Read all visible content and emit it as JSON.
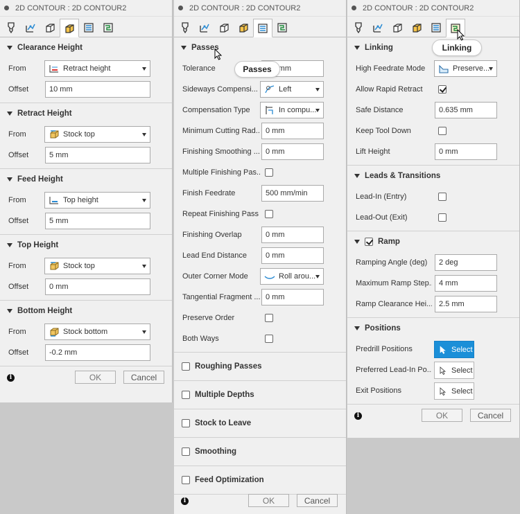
{
  "window_title": "2D CONTOUR : 2D CONTOUR2",
  "tabs": [
    "tool-icon",
    "geometry-icon",
    "heights-icon",
    "passes-icon",
    "linking-icon",
    "link-active-icon"
  ],
  "heights_panel": {
    "sections": [
      {
        "title": "Clearance Height",
        "from_label": "From",
        "from_value": "Retract height",
        "from_icon": "retract-height-icon",
        "offset_label": "Offset",
        "offset_value": "10 mm"
      },
      {
        "title": "Retract Height",
        "from_label": "From",
        "from_value": "Stock top",
        "from_icon": "stock-top-icon",
        "offset_label": "Offset",
        "offset_value": "5 mm"
      },
      {
        "title": "Feed Height",
        "from_label": "From",
        "from_value": "Top height",
        "from_icon": "top-height-icon",
        "offset_label": "Offset",
        "offset_value": "5 mm"
      },
      {
        "title": "Top Height",
        "from_label": "From",
        "from_value": "Stock top",
        "from_icon": "stock-top-icon",
        "offset_label": "Offset",
        "offset_value": "0 mm"
      },
      {
        "title": "Bottom Height",
        "from_label": "From",
        "from_value": "Stock bottom",
        "from_icon": "stock-bottom-icon",
        "offset_label": "Offset",
        "offset_value": "-0.2 mm"
      }
    ]
  },
  "passes_panel": {
    "section_title": "Passes",
    "tooltip": "Passes",
    "tolerance_label": "Tolerance",
    "tolerance_value": "mm",
    "sideways_label": "Sideways Compensi...",
    "sideways_value": "Left",
    "comp_type_label": "Compensation Type",
    "comp_type_value": "In compu...",
    "min_cut_label": "Minimum Cutting Rad...",
    "min_cut_value": "0 mm",
    "finish_smooth_label": "Finishing Smoothing ...",
    "finish_smooth_value": "0 mm",
    "multi_finish_label": "Multiple Finishing Pas...",
    "finish_feed_label": "Finish Feedrate",
    "finish_feed_value": "500 mm/min",
    "repeat_finish_label": "Repeat Finishing Pass",
    "finish_overlap_label": "Finishing Overlap",
    "finish_overlap_value": "0 mm",
    "lead_end_label": "Lead End Distance",
    "lead_end_value": "0 mm",
    "outer_corner_label": "Outer Corner Mode",
    "outer_corner_value": "Roll arou...",
    "tangential_label": "Tangential Fragment ...",
    "tangential_value": "0 mm",
    "preserve_label": "Preserve Order",
    "both_ways_label": "Both Ways",
    "collapsed_sections": [
      "Roughing Passes",
      "Multiple Depths",
      "Stock to Leave",
      "Smoothing",
      "Feed Optimization"
    ]
  },
  "linking_panel": {
    "section_title": "Linking",
    "tooltip": "Linking",
    "hf_mode_label": "High Feedrate Mode",
    "hf_mode_value": "Preserve...",
    "allow_rapid_label": "Allow Rapid Retract",
    "safe_dist_label": "Safe Distance",
    "safe_dist_value": "0.635 mm",
    "keep_tool_label": "Keep Tool Down",
    "lift_label": "Lift Height",
    "lift_value": "0 mm",
    "leads_title": "Leads & Transitions",
    "lead_in_label": "Lead-In (Entry)",
    "lead_out_label": "Lead-Out (Exit)",
    "ramp_title": "Ramp",
    "ramp_angle_label": "Ramping Angle (deg)",
    "ramp_angle_value": "2 deg",
    "max_ramp_label": "Maximum Ramp Step...",
    "max_ramp_value": "4 mm",
    "ramp_clear_label": "Ramp Clearance Hei...",
    "ramp_clear_value": "2.5 mm",
    "positions_title": "Positions",
    "predrill_label": "Predrill Positions",
    "preferred_label": "Preferred Lead-In Po...",
    "exit_label": "Exit Positions",
    "select_label": "Select"
  },
  "footer": {
    "ok": "OK",
    "cancel": "Cancel",
    "info": "i"
  },
  "colors": {
    "panel_bg": "#f0f0f0",
    "accent": "#1b8fd8",
    "desktop": "#c9c9c9"
  }
}
